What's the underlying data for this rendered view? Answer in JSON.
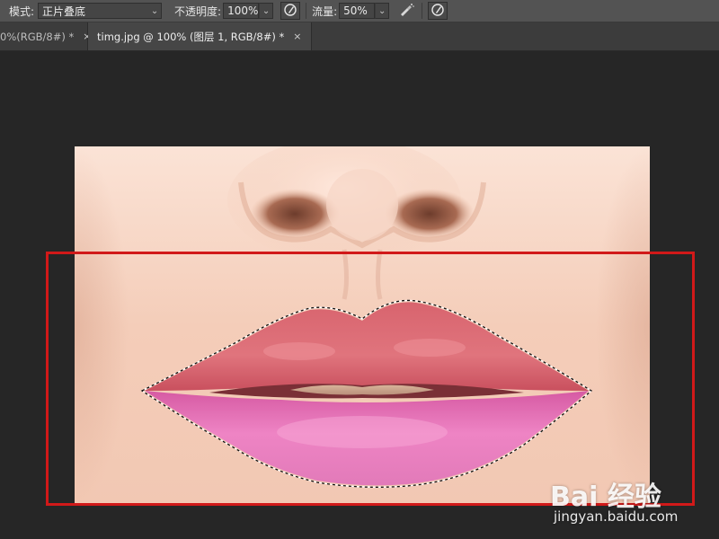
{
  "options_bar": {
    "mode_label": "模式:",
    "mode_value": "正片叠底",
    "opacity_label": "不透明度:",
    "opacity_value": "100%",
    "flow_label": "流量:",
    "flow_value": "50%"
  },
  "tabs": [
    {
      "label": "0%(RGB/8#) *",
      "close": "×",
      "active": false
    },
    {
      "label": "timg.jpg @ 100% (图层 1, RGB/8#) *",
      "close": "×",
      "active": true
    }
  ],
  "watermark": {
    "logo_text": "Bai 经验",
    "url": "jingyan.baidu.com"
  },
  "colors": {
    "highlight_box": "#d11919",
    "canvas_bg": "#262626",
    "toolbar_bg": "#535353"
  },
  "icons": {
    "pressure_opacity": "stylus-pressure-icon",
    "airbrush": "airbrush-icon",
    "pressure_size": "stylus-pressure-icon"
  }
}
